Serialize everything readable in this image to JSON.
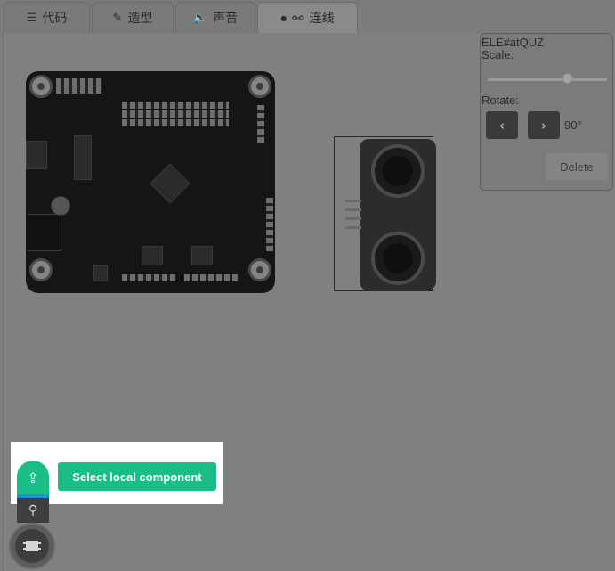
{
  "tabs": [
    {
      "label": "代码",
      "icon": "code-icon",
      "active": false
    },
    {
      "label": "造型",
      "icon": "brush-icon",
      "active": false
    },
    {
      "label": "声音",
      "icon": "speaker-icon",
      "active": false
    },
    {
      "label": "连线",
      "icon": "wire-icon",
      "active": true
    }
  ],
  "properties": {
    "element_id": "ELE#atQUZ",
    "scale_label": "Scale:",
    "scale_value": 0.7,
    "rotate_label": "Rotate:",
    "rotate_left_icon": "‹",
    "rotate_right_icon": "›",
    "rotate_value": "90°",
    "delete_label": "Delete"
  },
  "toolbar": {
    "upload_icon": "⇪",
    "search_icon": "⚲",
    "tooltip": "Select local component"
  },
  "colors": {
    "accent": "#1abd85",
    "strip": "#2a8bd6"
  }
}
